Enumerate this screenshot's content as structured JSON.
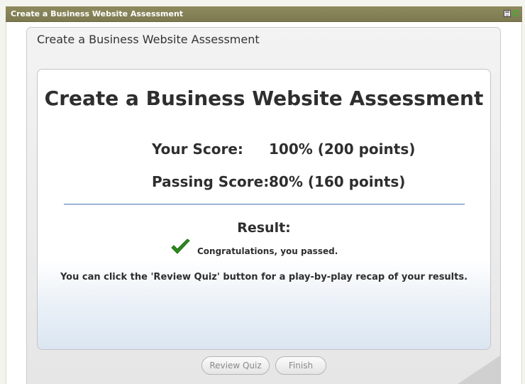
{
  "window": {
    "title": "Create a Business Website Assessment",
    "icons": [
      "save-icon",
      "refresh-icon"
    ]
  },
  "slide": {
    "title": "Create a Business Website Assessment"
  },
  "results": {
    "heading": "Create a Business Website Assessment",
    "your_score_label": "Your Score:",
    "your_score_value": "100% (200 points)",
    "passing_score_label": "Passing Score:",
    "passing_score_value": "80% (160 points)",
    "result_label": "Result:",
    "result_icon": "checkmark-icon",
    "result_message": "Congratulations, you passed.",
    "review_note": "You can click the 'Review Quiz' button for a play-by-play recap of your results."
  },
  "buttons": {
    "review_quiz": "Review Quiz",
    "finish": "Finish"
  },
  "colors": {
    "titlebar": "#8e8a5e",
    "check": "#2f8a1e",
    "divider": "#6c93c4"
  }
}
